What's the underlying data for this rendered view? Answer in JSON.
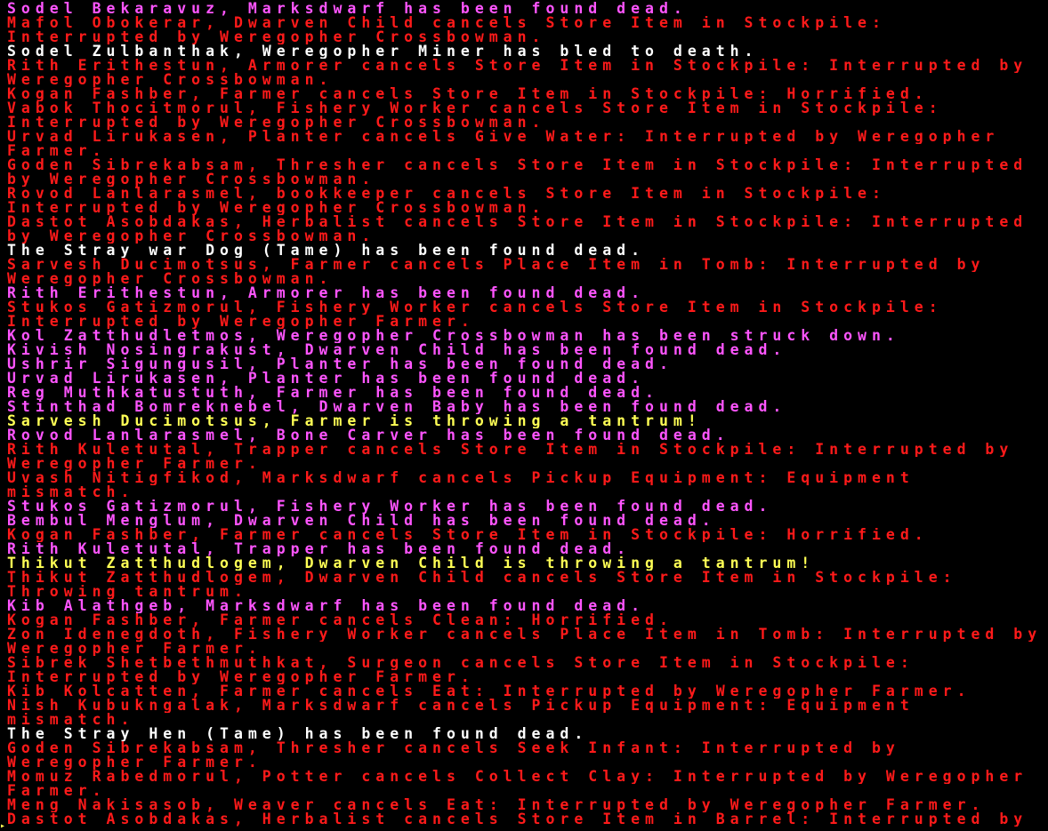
{
  "colors": {
    "red": "#ff1a1a",
    "magenta": "#ff55ff",
    "white": "#ffffff",
    "yellow": "#ffff55",
    "background": "#000000"
  },
  "log_lines": [
    {
      "text": "Sodel Bekaravuz, Marksdwarf has been found dead.",
      "color": "magenta"
    },
    {
      "text": "Mafol Obokerar, Dwarven Child cancels Store Item in Stockpile:",
      "color": "red"
    },
    {
      "text": "Interrupted by Weregopher Crossbowman.",
      "color": "red"
    },
    {
      "text": "Sodel Zulbanthak, Weregopher Miner has bled to death.",
      "color": "white"
    },
    {
      "text": "Rith Erithestun, Armorer cancels Store Item in Stockpile: Interrupted by",
      "color": "red"
    },
    {
      "text": "Weregopher Crossbowman.",
      "color": "red"
    },
    {
      "text": "Kogan Fashber, Farmer cancels Store Item in Stockpile: Horrified.",
      "color": "red"
    },
    {
      "text": "Vabok Thocitmorul, Fishery Worker cancels Store Item in Stockpile:",
      "color": "red"
    },
    {
      "text": "Interrupted by Weregopher Crossbowman.",
      "color": "red"
    },
    {
      "text": "Urvad Lirukasen, Planter cancels Give Water: Interrupted by Weregopher",
      "color": "red"
    },
    {
      "text": "Farmer.",
      "color": "red"
    },
    {
      "text": "Goden Sibrekabsam, Thresher cancels Store Item in Stockpile: Interrupted",
      "color": "red"
    },
    {
      "text": "by Weregopher Crossbowman.",
      "color": "red"
    },
    {
      "text": "Rovod Lanlarasmel, bookkeeper cancels Store Item in Stockpile:",
      "color": "red"
    },
    {
      "text": "Interrupted by Weregopher Crossbowman.",
      "color": "red"
    },
    {
      "text": "Dastot Asobdakas, Herbalist cancels Store Item in Stockpile: Interrupted",
      "color": "red"
    },
    {
      "text": "by Weregopher Crossbowman.",
      "color": "red"
    },
    {
      "text": "The Stray war Dog (Tame) has been found dead.",
      "color": "white"
    },
    {
      "text": "Sarvesh Ducimotsus, Farmer cancels Place Item in Tomb: Interrupted by",
      "color": "red"
    },
    {
      "text": "Weregopher Crossbowman.",
      "color": "red"
    },
    {
      "text": "Rith Erithestun, Armorer has been found dead.",
      "color": "magenta"
    },
    {
      "text": "Stukos Gatizmorul, Fishery Worker cancels Store Item in Stockpile:",
      "color": "red"
    },
    {
      "text": "Interrupted by Weregopher Farmer.",
      "color": "red"
    },
    {
      "text": "Kol Zatthudletmos, Weregopher Crossbowman has been struck down.",
      "color": "magenta"
    },
    {
      "text": "Kivish Nosingrakust, Dwarven Child has been found dead.",
      "color": "magenta"
    },
    {
      "text": "Ushrir Sigungusil, Planter has been found dead.",
      "color": "magenta"
    },
    {
      "text": "Urvad Lirukasen, Planter has been found dead.",
      "color": "magenta"
    },
    {
      "text": "Reg Muthkatustuth, Farmer has been found dead.",
      "color": "magenta"
    },
    {
      "text": "Stinthad Bomreknebel, Dwarven Baby has been found dead.",
      "color": "magenta"
    },
    {
      "text": "Sarvesh Ducimotsus, Farmer is throwing a tantrum!",
      "color": "yellow"
    },
    {
      "text": "Rovod Lanlarasmel, Bone Carver has been found dead.",
      "color": "magenta"
    },
    {
      "text": "Rith Kuletutal, Trapper cancels Store Item in Stockpile: Interrupted by",
      "color": "red"
    },
    {
      "text": "Weregopher Farmer.",
      "color": "red"
    },
    {
      "text": "Uvash Nitigfikod, Marksdwarf cancels Pickup Equipment: Equipment",
      "color": "red"
    },
    {
      "text": "mismatch.",
      "color": "red"
    },
    {
      "text": "Stukos Gatizmorul, Fishery Worker has been found dead.",
      "color": "magenta"
    },
    {
      "text": "Bembul Menglum, Dwarven Child has been found dead.",
      "color": "magenta"
    },
    {
      "text": "Kogan Fashber, Farmer cancels Store Item in Stockpile: Horrified.",
      "color": "red"
    },
    {
      "text": "Rith Kuletutal, Trapper has been found dead.",
      "color": "magenta"
    },
    {
      "text": "Thikut Zatthudlogem, Dwarven Child is throwing a tantrum!",
      "color": "yellow"
    },
    {
      "text": "Thikut Zatthudlogem, Dwarven Child cancels Store Item in Stockpile:",
      "color": "red"
    },
    {
      "text": "Throwing tantrum.",
      "color": "red"
    },
    {
      "text": "Kib Alathgeb, Marksdwarf has been found dead.",
      "color": "magenta"
    },
    {
      "text": "Kogan Fashber, Farmer cancels Clean: Horrified.",
      "color": "red"
    },
    {
      "text": "Zon Idenegdoth, Fishery Worker cancels Place Item in Tomb: Interrupted by",
      "color": "red"
    },
    {
      "text": "Weregopher Farmer.",
      "color": "red"
    },
    {
      "text": "Sibrek Shetbethmuthkat, Surgeon cancels Store Item in Stockpile:",
      "color": "red"
    },
    {
      "text": "Interrupted by Weregopher Farmer.",
      "color": "red"
    },
    {
      "text": "Kib Kolcatten, Farmer cancels Eat: Interrupted by Weregopher Farmer.",
      "color": "red"
    },
    {
      "text": "Nish Kubukngalak, Marksdwarf cancels Pickup Equipment: Equipment",
      "color": "red"
    },
    {
      "text": "mismatch.",
      "color": "red"
    },
    {
      "text": "The Stray Hen (Tame) has been found dead.",
      "color": "white"
    },
    {
      "text": "Goden Sibrekabsam, Thresher cancels Seek Infant: Interrupted by",
      "color": "red"
    },
    {
      "text": "Weregopher Farmer.",
      "color": "red"
    },
    {
      "text": "Momuz Rabedmorul, Potter cancels Collect Clay: Interrupted by Weregopher",
      "color": "red"
    },
    {
      "text": "Farmer.",
      "color": "red"
    },
    {
      "text": "Meng Nakisasob, Weaver cancels Eat: Interrupted by Weregopher Farmer.",
      "color": "red"
    },
    {
      "text": "Dastot Asobdakas, Herbalist cancels Store Item in Barrel: Interrupted by",
      "color": "red"
    }
  ]
}
